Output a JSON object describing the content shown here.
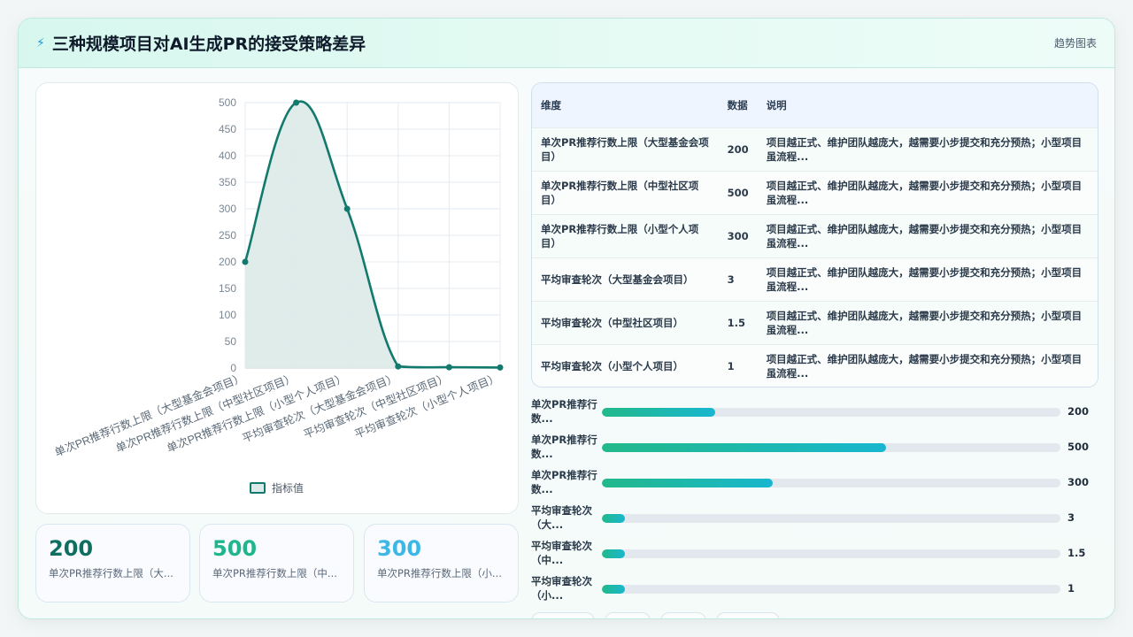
{
  "header": {
    "icon": "lightning-icon",
    "title": "三种规模项目对AI生成PR的接受策略差异",
    "tag": "趋势图表"
  },
  "chart_data": {
    "type": "area",
    "categories": [
      "单次PR推荐行数上限（大型基金会项目）",
      "单次PR推荐行数上限（中型社区项目）",
      "单次PR推荐行数上限（小型个人项目）",
      "平均审查轮次（大型基金会项目）",
      "平均审查轮次（中型社区项目）",
      "平均审查轮次（小型个人项目）"
    ],
    "series": [
      {
        "name": "指标值",
        "values": [
          200,
          500,
          300,
          3,
          1.5,
          1
        ]
      }
    ],
    "ylim": [
      0,
      500
    ],
    "yticks": [
      0,
      50,
      100,
      150,
      200,
      250,
      300,
      350,
      400,
      450,
      500
    ],
    "grid": true,
    "legend": "bottom",
    "colors": {
      "line": "#127a6c",
      "fill": "#dbeae8",
      "grid": "#e3ebf2"
    }
  },
  "stats": [
    {
      "value": "200",
      "label": "单次PR推荐行数上限（大...",
      "color": "#0e6e5f"
    },
    {
      "value": "500",
      "label": "单次PR推荐行数上限（中...",
      "color": "#20b58c"
    },
    {
      "value": "300",
      "label": "单次PR推荐行数上限（小...",
      "color": "#3db7e6"
    }
  ],
  "table": {
    "headers": [
      "维度",
      "数据",
      "说明"
    ],
    "rows": [
      [
        "单次PR推荐行数上限（大型基金会项目）",
        "200",
        "项目越正式、维护团队越庞大，越需要小步提交和充分预热；小型项目虽流程..."
      ],
      [
        "单次PR推荐行数上限（中型社区项目）",
        "500",
        "项目越正式、维护团队越庞大，越需要小步提交和充分预热；小型项目虽流程..."
      ],
      [
        "单次PR推荐行数上限（小型个人项目）",
        "300",
        "项目越正式、维护团队越庞大，越需要小步提交和充分预热；小型项目虽流程..."
      ],
      [
        "平均审查轮次（大型基金会项目）",
        "3",
        "项目越正式、维护团队越庞大，越需要小步提交和充分预热；小型项目虽流程..."
      ],
      [
        "平均审查轮次（中型社区项目）",
        "1.5",
        "项目越正式、维护团队越庞大，越需要小步提交和充分预热；小型项目虽流程..."
      ],
      [
        "平均审查轮次（小型个人项目）",
        "1",
        "项目越正式、维护团队越庞大，越需要小步提交和充分预热；小型项目虽流程..."
      ]
    ]
  },
  "bars": [
    {
      "label": "单次PR推荐行数...",
      "value": "200",
      "fraction": 0.248
    },
    {
      "label": "单次PR推荐行数...",
      "value": "500",
      "fraction": 0.62
    },
    {
      "label": "单次PR推荐行数...",
      "value": "300",
      "fraction": 0.372
    },
    {
      "label": "平均审查轮次（大...",
      "value": "3",
      "fraction": 0.05
    },
    {
      "label": "平均审查轮次（中...",
      "value": "1.5",
      "fraction": 0.05
    },
    {
      "label": "平均审查轮次（小...",
      "value": "1",
      "fraction": 0.05
    }
  ]
}
